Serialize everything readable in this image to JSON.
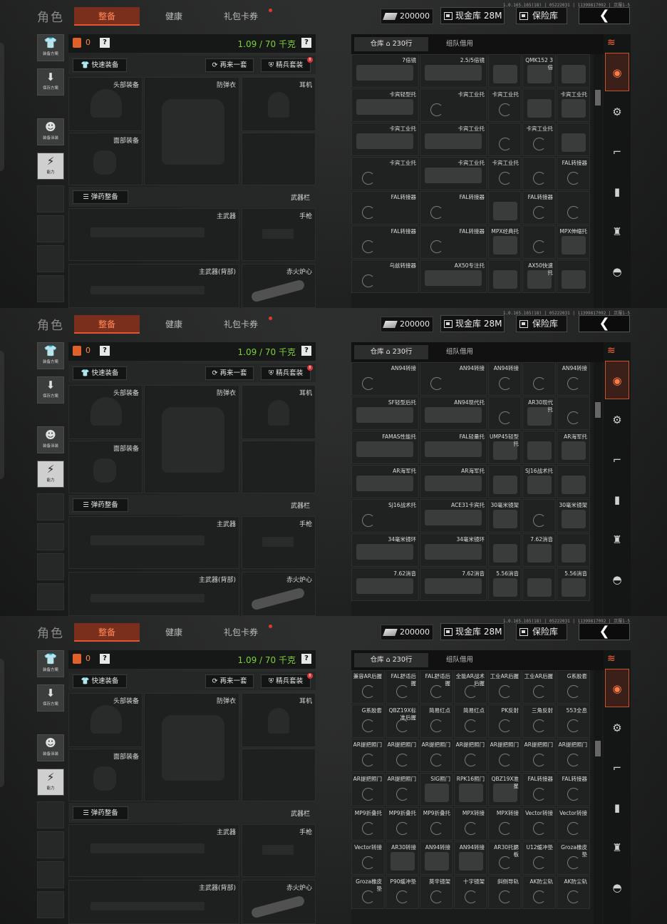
{
  "common": {
    "role_title": "角色",
    "tabs": [
      "整备",
      "健康",
      "礼包卡券"
    ],
    "version": "1.0.165.165(18) | 05222031 | 11399817092 | 正服1-5",
    "money": "200000",
    "cash_label": "现金库 28M",
    "safe_label": "保险库",
    "back_glyph": "❮",
    "left_buttons": [
      {
        "glyph": "👕",
        "caption": "装备方案"
      },
      {
        "glyph": "⬇",
        "caption": "保存方案"
      },
      {
        "glyph": "☻",
        "caption": "装备涂装"
      },
      {
        "glyph": "⚡",
        "caption": "能力"
      }
    ],
    "bag_count": "0",
    "help": "?",
    "weight": "1.09 / 70 千克",
    "quick_equip": "快速装备",
    "again": "再来一套",
    "elite": "精兵套装",
    "elite_badge": "8",
    "slots": {
      "helmet": "头部装备",
      "armor": "防弹衣",
      "ear": "耳机",
      "face": "面部装备",
      "primary": "主武器",
      "pistol": "手枪",
      "primary_back": "主武器(背部)",
      "melee": "赤火炉心"
    },
    "ammo_btn": "弹药整备",
    "weapon_bar": "武器栏",
    "stash_tab": "仓库",
    "stash_rows": "230行",
    "team_credit": "组队借用",
    "categories": [
      "stack-icon",
      "backpack-icon",
      "gear-icon",
      "rifle-icon",
      "magazine-icon",
      "bottle-icon",
      "helmet-icon"
    ]
  },
  "panels": [
    {
      "cells": [
        {
          "c": 0,
          "r": 0,
          "w": 2,
          "name": "7倍镜",
          "img": true
        },
        {
          "c": 2,
          "r": 0,
          "w": 2,
          "name": "2.5/5倍镜",
          "img": true
        },
        {
          "c": 4,
          "r": 0,
          "w": 1,
          "name": "",
          "img": true
        },
        {
          "c": 5,
          "r": 0,
          "w": 1,
          "name": "QMK152 3倍",
          "img": true
        },
        {
          "c": 6,
          "r": 0,
          "w": 1,
          "name": "",
          "img": true
        },
        {
          "c": 0,
          "r": 1,
          "w": 2,
          "name": "卡宾轻型托",
          "img": true
        },
        {
          "c": 2,
          "r": 1,
          "w": 2,
          "name": "卡宾工业托",
          "img": false
        },
        {
          "c": 4,
          "r": 1,
          "w": 1,
          "name": "卡宾工业托",
          "img": false
        },
        {
          "c": 5,
          "r": 1,
          "w": 1,
          "name": "",
          "img": true
        },
        {
          "c": 6,
          "r": 1,
          "w": 1,
          "name": "卡宾工业托",
          "img": true
        },
        {
          "c": 0,
          "r": 2,
          "w": 2,
          "name": "卡宾工业托",
          "img": true
        },
        {
          "c": 2,
          "r": 2,
          "w": 2,
          "name": "卡宾工业托",
          "img": true
        },
        {
          "c": 4,
          "r": 2,
          "w": 1,
          "name": "",
          "img": false
        },
        {
          "c": 5,
          "r": 2,
          "w": 1,
          "name": "卡宾工业托",
          "img": false
        },
        {
          "c": 6,
          "r": 2,
          "w": 1,
          "name": "",
          "img": true
        },
        {
          "c": 0,
          "r": 3,
          "w": 2,
          "name": "卡宾工业托",
          "img": false
        },
        {
          "c": 2,
          "r": 3,
          "w": 2,
          "name": "卡宾工业托",
          "img": true
        },
        {
          "c": 4,
          "r": 3,
          "w": 1,
          "name": "卡宾工业托",
          "img": false
        },
        {
          "c": 5,
          "r": 3,
          "w": 1,
          "name": "",
          "img": false
        },
        {
          "c": 6,
          "r": 3,
          "w": 1,
          "name": "FAL转接器",
          "img": false
        },
        {
          "c": 0,
          "r": 4,
          "w": 2,
          "name": "FAL转接器",
          "img": false
        },
        {
          "c": 2,
          "r": 4,
          "w": 2,
          "name": "FAL转接器",
          "img": false
        },
        {
          "c": 4,
          "r": 4,
          "w": 1,
          "name": "",
          "img": true
        },
        {
          "c": 5,
          "r": 4,
          "w": 1,
          "name": "FAL转接器",
          "img": false
        },
        {
          "c": 6,
          "r": 4,
          "w": 1,
          "name": "",
          "img": false
        },
        {
          "c": 0,
          "r": 5,
          "w": 2,
          "name": "FAL转接器",
          "img": false
        },
        {
          "c": 2,
          "r": 5,
          "w": 2,
          "name": "FAL转接器",
          "img": false
        },
        {
          "c": 4,
          "r": 5,
          "w": 1,
          "name": "MPX经典托",
          "img": true
        },
        {
          "c": 5,
          "r": 5,
          "w": 1,
          "name": "",
          "img": false
        },
        {
          "c": 6,
          "r": 5,
          "w": 1,
          "name": "MPX伸缩托",
          "img": true
        },
        {
          "c": 0,
          "r": 6,
          "w": 2,
          "name": "乌兹转接器",
          "img": false
        },
        {
          "c": 2,
          "r": 6,
          "w": 2,
          "name": "AX50专注托",
          "img": true
        },
        {
          "c": 4,
          "r": 6,
          "w": 1,
          "name": "",
          "img": true
        },
        {
          "c": 5,
          "r": 6,
          "w": 1,
          "name": "AX50快速托",
          "img": true
        },
        {
          "c": 6,
          "r": 6,
          "w": 1,
          "name": "",
          "img": true
        }
      ],
      "thumb_pos": 0.15
    },
    {
      "cells": [
        {
          "c": 0,
          "r": 0,
          "w": 2,
          "name": "AN94转接",
          "img": false
        },
        {
          "c": 2,
          "r": 0,
          "w": 2,
          "name": "AN94转接",
          "img": false
        },
        {
          "c": 4,
          "r": 0,
          "w": 1,
          "name": "AN94转接",
          "img": false
        },
        {
          "c": 5,
          "r": 0,
          "w": 1,
          "name": "",
          "img": false
        },
        {
          "c": 6,
          "r": 0,
          "w": 1,
          "name": "AN94转接",
          "img": false
        },
        {
          "c": 0,
          "r": 1,
          "w": 2,
          "name": "SF轻型后托",
          "img": true
        },
        {
          "c": 2,
          "r": 1,
          "w": 2,
          "name": "AN94现代托",
          "img": true
        },
        {
          "c": 4,
          "r": 1,
          "w": 1,
          "name": "",
          "img": false
        },
        {
          "c": 5,
          "r": 1,
          "w": 1,
          "name": "AR30现代托",
          "img": true
        },
        {
          "c": 6,
          "r": 1,
          "w": 1,
          "name": "",
          "img": false
        },
        {
          "c": 0,
          "r": 2,
          "w": 2,
          "name": "FAMAS性能托",
          "img": true
        },
        {
          "c": 2,
          "r": 2,
          "w": 2,
          "name": "FAL轻量托",
          "img": true
        },
        {
          "c": 4,
          "r": 2,
          "w": 1,
          "name": "UMP45轻型托",
          "img": true
        },
        {
          "c": 5,
          "r": 2,
          "w": 1,
          "name": "",
          "img": true
        },
        {
          "c": 6,
          "r": 2,
          "w": 1,
          "name": "AR海军托",
          "img": true
        },
        {
          "c": 0,
          "r": 3,
          "w": 2,
          "name": "AR海军托",
          "img": true
        },
        {
          "c": 2,
          "r": 3,
          "w": 2,
          "name": "AR海军托",
          "img": true
        },
        {
          "c": 4,
          "r": 3,
          "w": 1,
          "name": "",
          "img": true
        },
        {
          "c": 5,
          "r": 3,
          "w": 1,
          "name": "SJ16战术托",
          "img": true
        },
        {
          "c": 6,
          "r": 3,
          "w": 1,
          "name": "",
          "img": true
        },
        {
          "c": 0,
          "r": 4,
          "w": 2,
          "name": "SJ16战术托",
          "img": false
        },
        {
          "c": 2,
          "r": 4,
          "w": 2,
          "name": "ACE31卡宾托",
          "img": true
        },
        {
          "c": 4,
          "r": 4,
          "w": 1,
          "name": "30毫米镜架",
          "img": true
        },
        {
          "c": 5,
          "r": 4,
          "w": 1,
          "name": "",
          "img": false
        },
        {
          "c": 6,
          "r": 4,
          "w": 1,
          "name": "30毫米镜架",
          "img": true
        },
        {
          "c": 0,
          "r": 5,
          "w": 2,
          "name": "34毫米镜环",
          "img": true
        },
        {
          "c": 2,
          "r": 5,
          "w": 2,
          "name": "34毫米镜环",
          "img": true
        },
        {
          "c": 4,
          "r": 5,
          "w": 1,
          "name": "",
          "img": true
        },
        {
          "c": 5,
          "r": 5,
          "w": 1,
          "name": "7.62消音",
          "img": true
        },
        {
          "c": 6,
          "r": 5,
          "w": 1,
          "name": "",
          "img": true
        },
        {
          "c": 0,
          "r": 6,
          "w": 2,
          "name": "7.62消音",
          "img": true
        },
        {
          "c": 2,
          "r": 6,
          "w": 2,
          "name": "7.62消音",
          "img": true
        },
        {
          "c": 4,
          "r": 6,
          "w": 1,
          "name": "5.56消音",
          "img": true
        },
        {
          "c": 5,
          "r": 6,
          "w": 1,
          "name": "",
          "img": true
        },
        {
          "c": 6,
          "r": 6,
          "w": 1,
          "name": "5.56消音",
          "img": true
        }
      ],
      "thumb_pos": 0.17
    },
    {
      "cells": [
        {
          "c": 0,
          "r": 0,
          "w": 1,
          "name": "兼容AR后握",
          "img": false
        },
        {
          "c": 1,
          "r": 0,
          "w": 1,
          "name": "FAL舒适后握",
          "img": false
        },
        {
          "c": 2,
          "r": 0,
          "w": 1,
          "name": "FAL舒适后握",
          "img": false
        },
        {
          "c": 3,
          "r": 0,
          "w": 1,
          "name": "全能AR战术后握",
          "img": false
        },
        {
          "c": 4,
          "r": 0,
          "w": 1,
          "name": "工业AR后握",
          "img": false
        },
        {
          "c": 5,
          "r": 0,
          "w": 1,
          "name": "工业AR后握",
          "img": false
        },
        {
          "c": 6,
          "r": 0,
          "w": 1,
          "name": "G系胶套",
          "img": false
        },
        {
          "c": 0,
          "r": 1,
          "w": 1,
          "name": "G系胶套",
          "img": false
        },
        {
          "c": 1,
          "r": 1,
          "w": 1,
          "name": "QBZ19X标准后握",
          "img": false
        },
        {
          "c": 2,
          "r": 1,
          "w": 1,
          "name": "简易红点",
          "img": false
        },
        {
          "c": 3,
          "r": 1,
          "w": 1,
          "name": "简易红点",
          "img": false
        },
        {
          "c": 4,
          "r": 1,
          "w": 1,
          "name": "PK反射",
          "img": false
        },
        {
          "c": 5,
          "r": 1,
          "w": 1,
          "name": "三角反射",
          "img": false
        },
        {
          "c": 6,
          "r": 1,
          "w": 1,
          "name": "553全息",
          "img": false
        },
        {
          "c": 0,
          "r": 2,
          "w": 1,
          "name": "AR提把照门",
          "img": false
        },
        {
          "c": 1,
          "r": 2,
          "w": 1,
          "name": "AR提把照门",
          "img": false
        },
        {
          "c": 2,
          "r": 2,
          "w": 1,
          "name": "AR提把照门",
          "img": false
        },
        {
          "c": 3,
          "r": 2,
          "w": 1,
          "name": "AR提把照门",
          "img": false
        },
        {
          "c": 4,
          "r": 2,
          "w": 1,
          "name": "AR提把照门",
          "img": false
        },
        {
          "c": 5,
          "r": 2,
          "w": 1,
          "name": "AR提把照门",
          "img": false
        },
        {
          "c": 6,
          "r": 2,
          "w": 1,
          "name": "AR提把照门",
          "img": false
        },
        {
          "c": 0,
          "r": 3,
          "w": 1,
          "name": "AR提把照门",
          "img": false
        },
        {
          "c": 1,
          "r": 3,
          "w": 1,
          "name": "AR提把照门",
          "img": false
        },
        {
          "c": 2,
          "r": 3,
          "w": 1,
          "name": "SIG照门",
          "img": true
        },
        {
          "c": 3,
          "r": 3,
          "w": 1,
          "name": "RPK16照门",
          "img": true
        },
        {
          "c": 4,
          "r": 3,
          "w": 1,
          "name": "QBZ19X准星",
          "img": true
        },
        {
          "c": 5,
          "r": 3,
          "w": 1,
          "name": "FAL转接器",
          "img": false
        },
        {
          "c": 6,
          "r": 3,
          "w": 1,
          "name": "FAL转接器",
          "img": false
        },
        {
          "c": 0,
          "r": 4,
          "w": 1,
          "name": "MP9折叠托",
          "img": false
        },
        {
          "c": 1,
          "r": 4,
          "w": 1,
          "name": "MP9折叠托",
          "img": false
        },
        {
          "c": 2,
          "r": 4,
          "w": 1,
          "name": "MP9折叠托",
          "img": false
        },
        {
          "c": 3,
          "r": 4,
          "w": 1,
          "name": "MPX转接",
          "img": false
        },
        {
          "c": 4,
          "r": 4,
          "w": 1,
          "name": "MPX转接",
          "img": false
        },
        {
          "c": 5,
          "r": 4,
          "w": 1,
          "name": "Vector转接",
          "img": false
        },
        {
          "c": 6,
          "r": 4,
          "w": 1,
          "name": "Vector转接",
          "img": false
        },
        {
          "c": 0,
          "r": 5,
          "w": 1,
          "name": "Vector转接",
          "img": false
        },
        {
          "c": 1,
          "r": 5,
          "w": 1,
          "name": "AR30转接",
          "img": true
        },
        {
          "c": 2,
          "r": 5,
          "w": 1,
          "name": "AN94转接",
          "img": true
        },
        {
          "c": 3,
          "r": 5,
          "w": 1,
          "name": "AN94转接",
          "img": true
        },
        {
          "c": 4,
          "r": 5,
          "w": 1,
          "name": "AR30托腮板",
          "img": false
        },
        {
          "c": 5,
          "r": 5,
          "w": 1,
          "name": "U12缓冲垫",
          "img": false
        },
        {
          "c": 6,
          "r": 5,
          "w": 1,
          "name": "Groza橡皮垫",
          "img": false
        },
        {
          "c": 0,
          "r": 6,
          "w": 1,
          "name": "Groza橡皮垫",
          "img": false
        },
        {
          "c": 1,
          "r": 6,
          "w": 1,
          "name": "P90缓冲垫",
          "img": false
        },
        {
          "c": 2,
          "r": 6,
          "w": 1,
          "name": "莫辛镜架",
          "img": false
        },
        {
          "c": 3,
          "r": 6,
          "w": 1,
          "name": "十字镜架",
          "img": false
        },
        {
          "c": 4,
          "r": 6,
          "w": 1,
          "name": "斜侧导轨",
          "img": false
        },
        {
          "c": 5,
          "r": 6,
          "w": 1,
          "name": "AK防尘轨",
          "img": false
        },
        {
          "c": 6,
          "r": 6,
          "w": 1,
          "name": "AK防尘轨",
          "img": false
        }
      ],
      "thumb_pos": 0.3
    }
  ]
}
